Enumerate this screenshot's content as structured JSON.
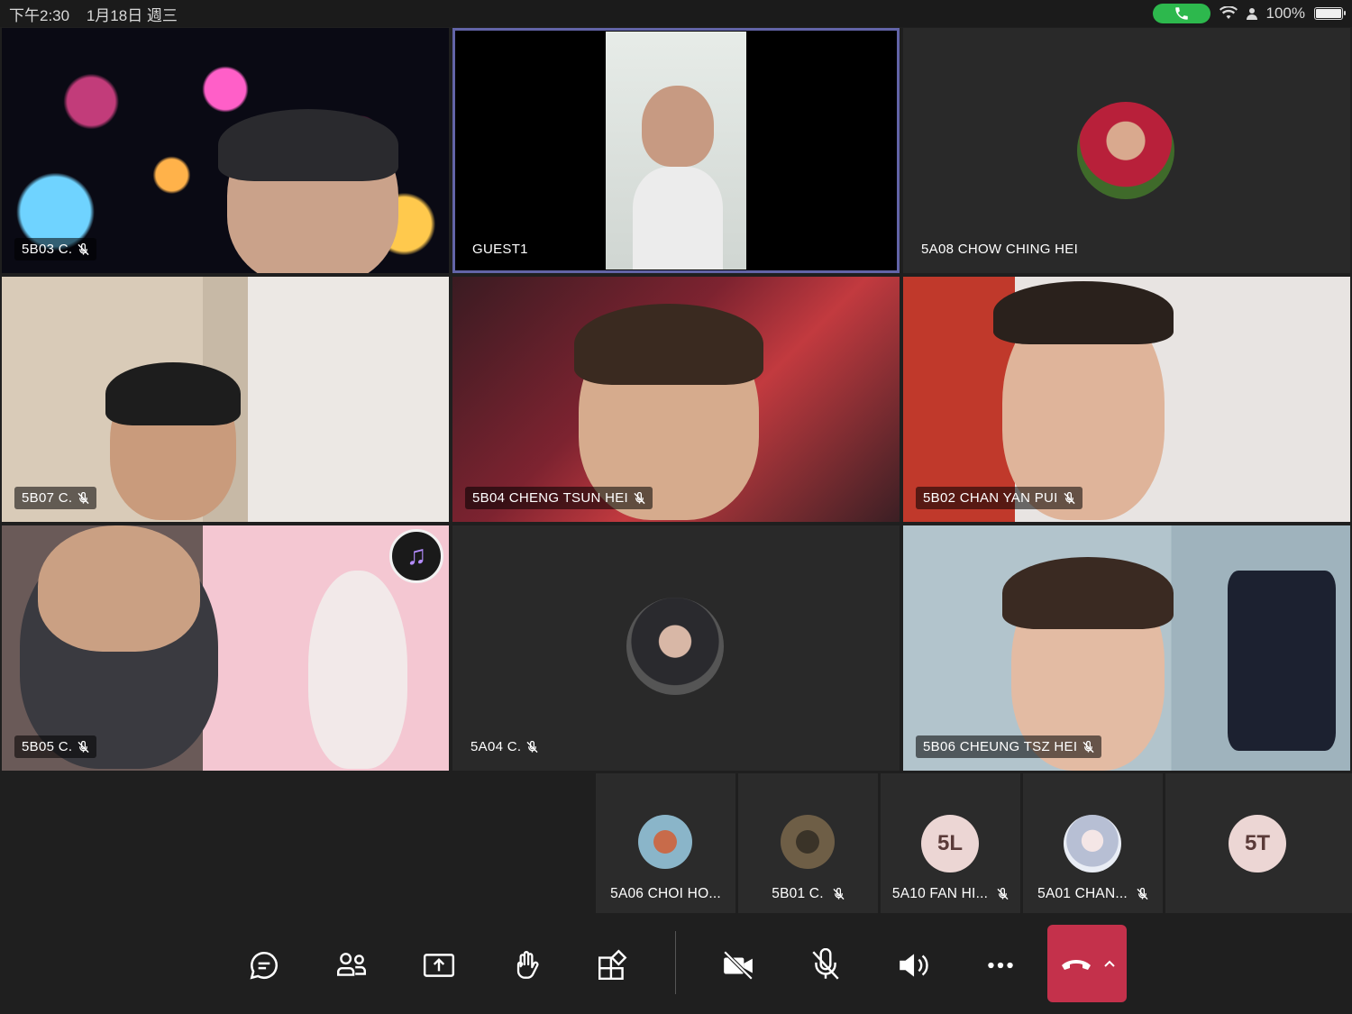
{
  "status_bar": {
    "time": "下午2:30",
    "date": "1月18日 週三",
    "battery": "100%"
  },
  "tiles": [
    {
      "label": "5B03 C.",
      "muted": true
    },
    {
      "label": "GUEST1",
      "muted": false,
      "active": true
    },
    {
      "label": "5A08 CHOW CHING HEI",
      "muted": false
    },
    {
      "label": "5B07 C.",
      "muted": true
    },
    {
      "label": "5B04 CHENG TSUN HEI",
      "muted": true
    },
    {
      "label": "5B02 CHAN YAN PUI",
      "muted": true
    },
    {
      "label": "5B05 C.",
      "muted": true
    },
    {
      "label": "5A04 C.",
      "muted": true
    },
    {
      "label": "5B06 CHEUNG TSZ HEI",
      "muted": true
    }
  ],
  "strip": [
    {
      "name": "5A06 CHOI HO...",
      "muted": false,
      "avatar": "photo"
    },
    {
      "name": "5B01 C.",
      "muted": true,
      "avatar": "photo"
    },
    {
      "name": "5A10 FAN HI...",
      "muted": true,
      "initials": "5L"
    },
    {
      "name": "5A01 CHAN...",
      "muted": true,
      "avatar": "photo"
    },
    {
      "name": "",
      "muted": false,
      "initials": "5T"
    }
  ],
  "toolbar": {
    "items": [
      "chat-icon",
      "people-icon",
      "share-icon",
      "raise-hand-icon",
      "apps-icon",
      "camera-off-icon",
      "mic-off-icon",
      "speaker-icon",
      "more-icon",
      "hang-up-icon"
    ]
  },
  "colors": {
    "active_outline": "#6264a7",
    "hangup": "#c4314b",
    "call_pill": "#2db84d",
    "initials_bg": "#ecd6d4"
  }
}
